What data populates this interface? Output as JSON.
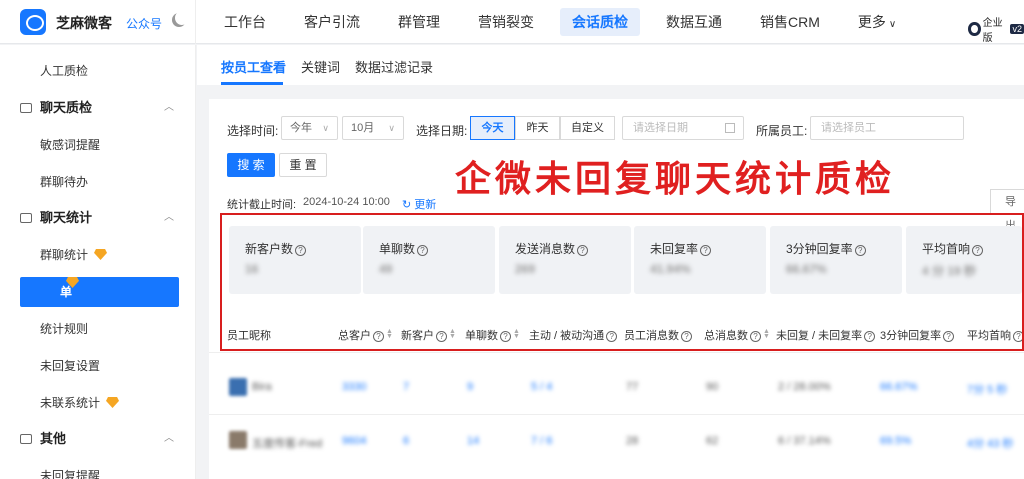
{
  "brand": {
    "name": "芝麻微客",
    "account_type": "公众号",
    "theme_icon": "moon-icon"
  },
  "nav": {
    "items": [
      "工作台",
      "客户引流",
      "群管理",
      "营销裂变",
      "会话质检",
      "数据互通",
      "销售CRM",
      "更多"
    ],
    "active": "会话质检",
    "edition": "企业版",
    "version": "v2"
  },
  "sidebar": {
    "top_item": "人工质检",
    "groups": [
      {
        "title": "聊天质检",
        "items": [
          "敏感词提醒",
          "群聊待办"
        ]
      },
      {
        "title": "聊天统计",
        "items": [
          "群聊统计",
          "单聊统计",
          "统计规则",
          "未回复设置",
          "未联系统计"
        ]
      },
      {
        "title": "其他",
        "items": [
          "未回复提醒"
        ]
      }
    ],
    "active_item": "单聊统计"
  },
  "tabs": [
    "按员工查看",
    "关键词",
    "数据过滤记录"
  ],
  "filters": {
    "time_label": "选择时间:",
    "year": "今年",
    "month": "10月",
    "date_label": "选择日期:",
    "date_options": [
      "今天",
      "昨天",
      "自定义"
    ],
    "date_active": "今天",
    "date_placeholder": "请选择日期",
    "staff_label": "所属员工:",
    "staff_placeholder": "请选择员工",
    "search_button": "搜 索",
    "reset_button": "重 置"
  },
  "stats_time": {
    "label": "统计截止时间:",
    "value": "2024-10-24 10:00",
    "refresh": "更新"
  },
  "export_label": "导 出",
  "overlay_title": "企微未回复聊天统计质检",
  "stat_cards": [
    {
      "title": "新客户数",
      "value": "16"
    },
    {
      "title": "单聊数",
      "value": "49"
    },
    {
      "title": "发送消息数",
      "value": "269"
    },
    {
      "title": "未回复率",
      "value": "41.94%"
    },
    {
      "title": "3分钟回复率",
      "value": "66.67%"
    },
    {
      "title": "平均首响",
      "value": "4 分 19 秒"
    }
  ],
  "table": {
    "columns": [
      "员工昵称",
      "总客户",
      "新客户",
      "单聊数",
      "主动 / 被动沟通",
      "员工消息数",
      "总消息数",
      "未回复 / 未回复率",
      "3分钟回复率",
      "平均首响"
    ],
    "rows": [
      [
        "Bira",
        "3330",
        "7",
        "9",
        "5 / 4",
        "77",
        "90",
        "2 / 28.00%",
        "66.67%",
        "7分 5 秒"
      ],
      [
        "五度传客-Fred",
        "9604",
        "6",
        "14",
        "7 / 6",
        "28",
        "62",
        "6 / 37.14%",
        "69.5%",
        "4分 43 秒"
      ]
    ]
  },
  "colors": {
    "primary": "#1677ff",
    "highlight_box": "#d81e1e",
    "vip": "#f5a623"
  }
}
